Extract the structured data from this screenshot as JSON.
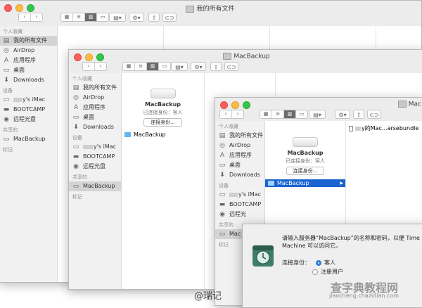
{
  "windows": {
    "w1": {
      "title": "我的所有文件",
      "sidebar": {
        "fav_header": "个人收藏",
        "items": [
          {
            "label": "我的所有文件",
            "icon": "all-files-icon"
          },
          {
            "label": "AirDrop",
            "icon": "airdrop-icon"
          },
          {
            "label": "应用程序",
            "icon": "applications-icon"
          },
          {
            "label": "桌面",
            "icon": "desktop-icon"
          },
          {
            "label": "Downloads",
            "icon": "downloads-icon"
          }
        ],
        "dev_header": "设备",
        "devices": [
          {
            "label": "y's iMac",
            "icon": "imac-icon"
          },
          {
            "label": "BOOTCAMP",
            "icon": "disk-icon"
          },
          {
            "label": "远程光盘",
            "icon": "remote-disc-icon"
          }
        ],
        "shared_header": "共享的",
        "shared": [
          {
            "label": "MacBackup",
            "icon": "server-icon"
          }
        ],
        "tags_header": "标记"
      }
    },
    "w2": {
      "title": "MacBackup",
      "sidebar": {
        "fav_header": "个人收藏",
        "items": [
          {
            "label": "我的所有文件"
          },
          {
            "label": "AirDrop"
          },
          {
            "label": "应用程序"
          },
          {
            "label": "桌面"
          },
          {
            "label": "Downloads"
          }
        ],
        "dev_header": "设备",
        "devices": [
          {
            "label": "y's iMac"
          },
          {
            "label": "BOOTCAMP"
          },
          {
            "label": "远程光盘"
          }
        ],
        "shared_header": "共享的",
        "shared": [
          {
            "label": "MacBackup"
          }
        ],
        "tags_header": "标记"
      },
      "server": {
        "name": "MacBackup",
        "status": "已连接身份：客人",
        "button": "连接身份..."
      },
      "folder": "MacBackup"
    },
    "w3": {
      "title": "Mac",
      "sidebar": {
        "fav_header": "个人收藏",
        "items": [
          {
            "label": "我的所有文件"
          },
          {
            "label": "AirDrop"
          },
          {
            "label": "应用程序"
          },
          {
            "label": "桌面"
          },
          {
            "label": "Downloads"
          }
        ],
        "dev_header": "设备",
        "devices": [
          {
            "label": "y's iMac"
          },
          {
            "label": "BOOTCAMP"
          },
          {
            "label": "远程光"
          }
        ],
        "shared_header": "共享的",
        "shared": [
          {
            "label": "Mac"
          }
        ],
        "tags_header": "标记"
      },
      "server": {
        "name": "MacBackup",
        "status": "已连接身份：客人",
        "button": "连接身份..."
      },
      "folder": "MacBackup",
      "bundle": "y的Mac...arsebundle"
    }
  },
  "dialog": {
    "message": "请输入服务器“MacBackup”的名称和密码，以便 Time Machine 可以访问它。",
    "connect_as_label": "连接身份：",
    "options": [
      {
        "label": "客人",
        "selected": true
      },
      {
        "label": "注册用户",
        "selected": false
      }
    ]
  },
  "watermark": {
    "author": "@瑞记",
    "site_cn": "查字典教程网",
    "site_url": "jiaocheng.chazidian.com"
  },
  "colors": {
    "selection": "#1a64d2",
    "accent": "#2d7de0"
  }
}
